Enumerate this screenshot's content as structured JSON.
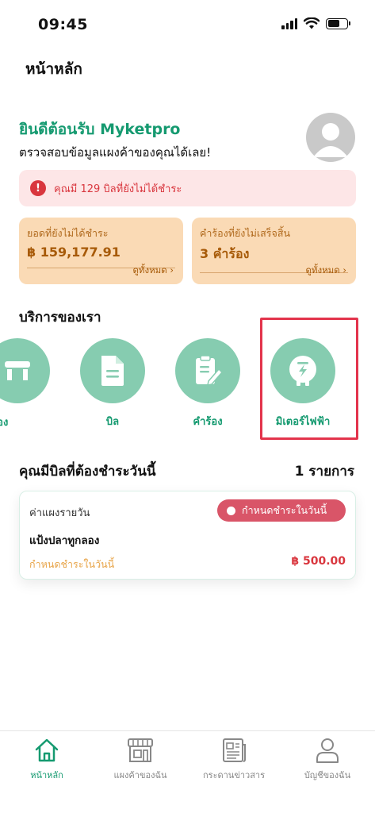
{
  "status_bar": {
    "time": "09:45"
  },
  "header": {
    "title": "หน้าหลัก"
  },
  "welcome": {
    "title": "ยินดีต้อนรับ Myketpro",
    "subtitle": "ตรวจสอบข้อมูลแผงค้าของคุณได้เลย!"
  },
  "alert": {
    "icon": "exclamation-icon",
    "text": "คุณมี 129 บิลที่ยังไม่ได้ชำระ"
  },
  "summary": {
    "unpaid": {
      "label": "ยอดที่ยังไม่ได้ชำระ",
      "value": "฿ 159,177.91",
      "link": "ดูทั้งหมด ›"
    },
    "requests": {
      "label": "คำร้องที่ยังไม่เสร็จสิ้น",
      "value": "3 คำร้อง",
      "link": "ดูทั้งหมด ›"
    }
  },
  "services": {
    "title": "บริการของเรา",
    "partial_label_line1": "ฯของ",
    "partial_label_line2": "น",
    "items": [
      {
        "label": "บิล",
        "icon": "document-icon"
      },
      {
        "label": "คำร้อง",
        "icon": "clipboard-edit-icon"
      },
      {
        "label": "มิเตอร์ไฟฟ้า",
        "icon": "electric-meter-icon"
      }
    ]
  },
  "due_today": {
    "title": "คุณมีบิลที่ต้องชำระวันนี้",
    "count": "1 รายการ",
    "bill": {
      "type": "ค่าแผงรายวัน",
      "badge": "กำหนดชำระในวันนี้",
      "shop": "แป้งปลาทูกลอง",
      "note": "กำหนดชำระในวันนี้",
      "amount": "฿ 500.00"
    }
  },
  "tabs": [
    {
      "label": "หน้าหลัก",
      "icon": "home-icon",
      "active": true
    },
    {
      "label": "แผงค้าของฉัน",
      "icon": "store-icon",
      "active": false
    },
    {
      "label": "กระดานข่าวสาร",
      "icon": "newspaper-icon",
      "active": false
    },
    {
      "label": "บัญชีของฉัน",
      "icon": "user-icon",
      "active": false
    }
  ],
  "colors": {
    "brand_green": "#159a70",
    "service_circle": "#86ccb0",
    "alert_red": "#d9363e",
    "card_orange": "#fadab5",
    "highlight_red": "#e3344c"
  }
}
